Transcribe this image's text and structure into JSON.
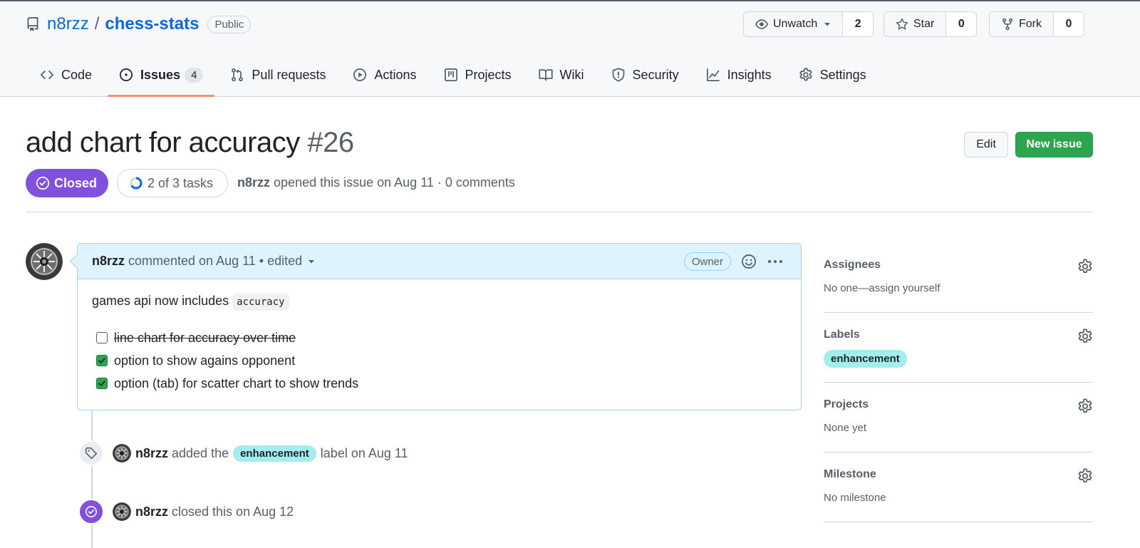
{
  "repo": {
    "owner": "n8rzz",
    "separator": "/",
    "name": "chess-stats",
    "visibility": "Public"
  },
  "actions": {
    "watch": {
      "label": "Unwatch",
      "count": "2"
    },
    "star": {
      "label": "Star",
      "count": "0"
    },
    "fork": {
      "label": "Fork",
      "count": "0"
    }
  },
  "nav": {
    "tabs": [
      {
        "label": "Code",
        "icon": "code-icon"
      },
      {
        "label": "Issues",
        "icon": "issue-opened-icon",
        "count": "4",
        "active": true
      },
      {
        "label": "Pull requests",
        "icon": "git-pull-request-icon"
      },
      {
        "label": "Actions",
        "icon": "play-icon"
      },
      {
        "label": "Projects",
        "icon": "table-icon"
      },
      {
        "label": "Wiki",
        "icon": "book-icon"
      },
      {
        "label": "Security",
        "icon": "shield-icon"
      },
      {
        "label": "Insights",
        "icon": "graph-icon"
      },
      {
        "label": "Settings",
        "icon": "gear-icon"
      }
    ]
  },
  "issue": {
    "title": "add chart for accuracy",
    "number": "#26",
    "edit_label": "Edit",
    "new_issue_label": "New issue",
    "state": "Closed",
    "tasks": "2 of 3 tasks",
    "author": "n8rzz",
    "meta_text": "opened this issue on Aug 11 · 0 comments",
    "colors": {
      "closed": "#8250df",
      "primary": "#2da44e",
      "label": "#a2eeef"
    }
  },
  "comment": {
    "author": "n8rzz",
    "meta": "commented on Aug 11 • edited",
    "role": "Owner",
    "body_prefix": "games api now includes",
    "body_code": "accuracy",
    "tasks": [
      {
        "text": "line chart for accuracy over time",
        "checked": false,
        "struck": true
      },
      {
        "text": "option to show agains opponent",
        "checked": true
      },
      {
        "text": "option (tab) for scatter chart to show trends",
        "checked": true
      }
    ]
  },
  "timeline": {
    "labeled": {
      "author": "n8rzz",
      "pre": "added the",
      "label": "enhancement",
      "post": "label on Aug 11"
    },
    "closed": {
      "author": "n8rzz",
      "text": "closed this on Aug 12"
    }
  },
  "sidebar": {
    "assignees": {
      "title": "Assignees",
      "value": "No one—assign yourself"
    },
    "labels": {
      "title": "Labels",
      "value": "enhancement"
    },
    "projects": {
      "title": "Projects",
      "value": "None yet"
    },
    "milestone": {
      "title": "Milestone",
      "value": "No milestone"
    }
  }
}
